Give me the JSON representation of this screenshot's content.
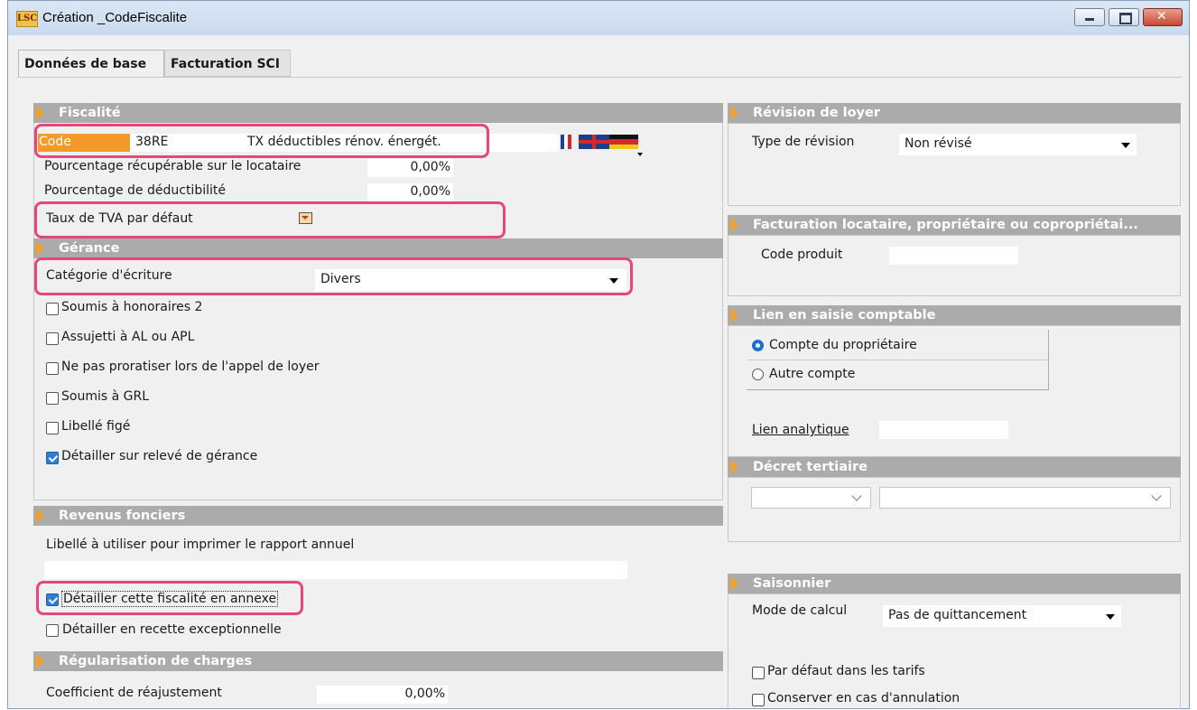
{
  "window": {
    "title": "Création _CodeFiscalite",
    "logo": "LSC"
  },
  "tabs": [
    "Données de base",
    "Facturation SCI"
  ],
  "fiscalite": {
    "header": "Fiscalité",
    "code_label": "Code",
    "code_value": "38RE",
    "libelle": "TX déductibles rénov. énergét.",
    "pct_recup_label": "Pourcentage récupérable sur le locataire",
    "pct_recup_value": "0,00%",
    "pct_deduct_label": "Pourcentage de déductibilité",
    "pct_deduct_value": "0,00%",
    "tva_label": "Taux de TVA par défaut"
  },
  "gerance": {
    "header": "Gérance",
    "categorie_label": "Catégorie d'écriture",
    "categorie_value": "Divers",
    "checkboxes": [
      {
        "label": "Soumis à honoraires 2",
        "checked": false
      },
      {
        "label": "Assujetti à AL ou APL",
        "checked": false
      },
      {
        "label": "Ne pas proratiser lors de l'appel de loyer",
        "checked": false
      },
      {
        "label": "Soumis à GRL",
        "checked": false
      },
      {
        "label": "Libellé figé",
        "checked": false
      },
      {
        "label": "Détailler sur relevé de gérance",
        "checked": true
      }
    ]
  },
  "revenus": {
    "header": "Revenus fonciers",
    "libelle_label": "Libellé à utiliser pour imprimer le rapport annuel",
    "libelle_value": "",
    "detail_annexe": {
      "label": "Détailler cette fiscalité en annexe",
      "checked": true
    },
    "detail_recette": {
      "label": "Détailler en recette exceptionnelle",
      "checked": false
    }
  },
  "regularisation": {
    "header": "Régularisation de charges",
    "coef_label": "Coefficient de réajustement",
    "coef_value": "0,00%"
  },
  "revision": {
    "header": "Révision de loyer",
    "type_label": "Type de révision",
    "type_value": "Non révisé"
  },
  "facturation": {
    "header": "Facturation locataire, propriétaire ou copropriétai...",
    "code_produit_label": "Code produit",
    "code_produit_value": ""
  },
  "lien": {
    "header": "Lien en saisie comptable",
    "radio1": "Compte du propriétaire",
    "radio2": "Autre compte",
    "selected": 1,
    "analytique_label": "Lien analytique"
  },
  "decret": {
    "header": "Décret tertiaire"
  },
  "saisonnier": {
    "header": "Saisonnier",
    "mode_label": "Mode de calcul",
    "mode_value": "Pas de quittancement",
    "cb1": {
      "label": "Par défaut dans les tarifs",
      "checked": false
    },
    "cb2": {
      "label": "Conserver en cas d'annulation",
      "checked": false
    }
  },
  "colors": {
    "accent": "#e8457a",
    "section": "#ababab",
    "arrow": "#f0a22e",
    "code_bg": "#f39a2a"
  }
}
